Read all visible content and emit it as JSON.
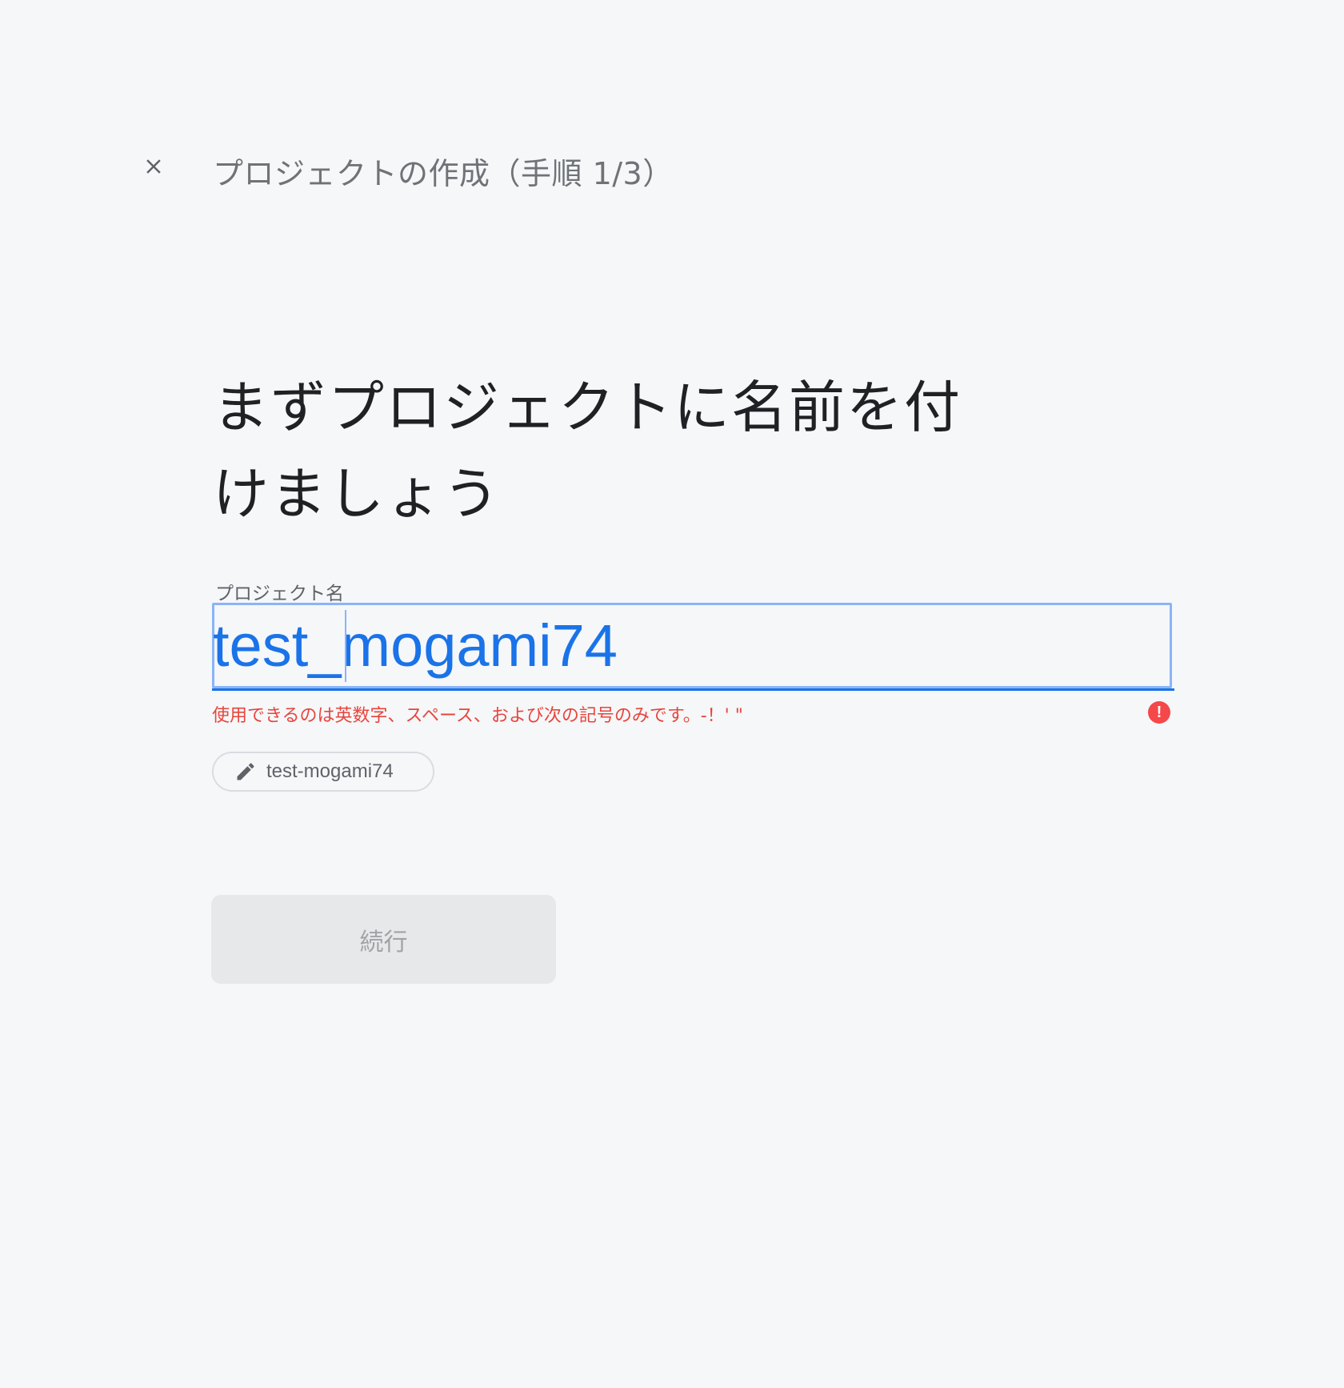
{
  "header": {
    "title": "プロジェクトの作成（手順 1/3）",
    "close_icon": "close-icon"
  },
  "main": {
    "heading_line1": "まずプロジェクトに名前を付",
    "heading_line2": "けましょう",
    "project_name_field": {
      "label": "プロジェクト名",
      "value": "test_mogami74"
    },
    "error": {
      "message": "使用できるのは英数字、スペース、および次の記号のみです。-！' \"",
      "icon": "error-icon"
    },
    "project_id_chip": {
      "icon": "pencil-icon",
      "value": "test-mogami74"
    },
    "continue_button": {
      "label": "続行",
      "disabled": true
    }
  },
  "colors": {
    "background": "#f5f7f9",
    "accent": "#1a73e8",
    "error": "#e8453c",
    "text_primary": "#202124",
    "text_secondary": "#5f6368"
  }
}
